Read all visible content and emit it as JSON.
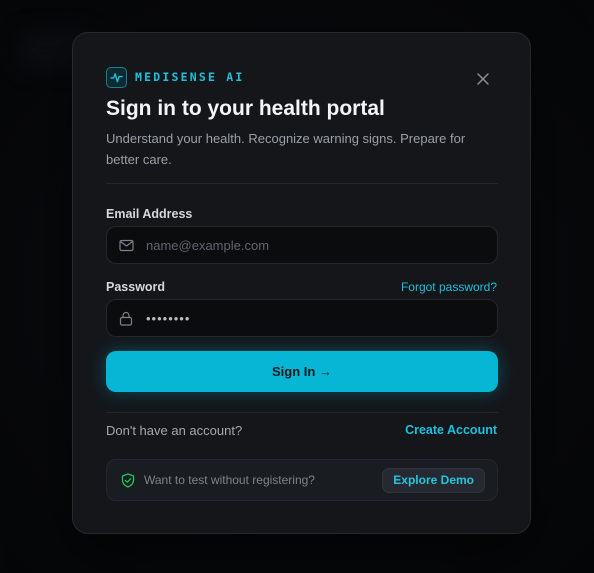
{
  "brand": {
    "name": "MEDISENSE AI",
    "logo_icon": "pulse-icon"
  },
  "modal": {
    "title": "Sign in to your health portal",
    "subtitle": "Understand your health. Recognize warning signs. Prepare for better care."
  },
  "email": {
    "label": "Email Address",
    "placeholder": "name@example.com",
    "value": "",
    "icon": "mail-icon"
  },
  "password": {
    "label": "Password",
    "masked_value": "••••••••",
    "forgot_label": "Forgot password?",
    "icon": "lock-icon"
  },
  "signin": {
    "label": "Sign In →"
  },
  "signup": {
    "prompt": "Don't have an account?",
    "create_label": "Create Account"
  },
  "demo": {
    "text": "Want to test without registering?",
    "button_label": "Explore Demo",
    "icon": "shield-check-icon"
  },
  "colors": {
    "accent": "#06b6d4",
    "link": "#1ec0dc",
    "modal_bg": "#14161a",
    "page_bg": "#060708"
  }
}
